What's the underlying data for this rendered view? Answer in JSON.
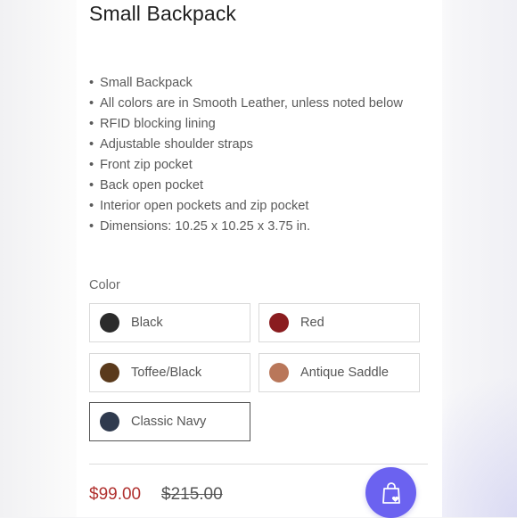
{
  "product": {
    "title": "Small Backpack",
    "features": [
      "Small Backpack",
      "All colors are in Smooth Leather, unless noted below",
      "RFID blocking lining",
      "Adjustable shoulder straps",
      "Front zip pocket",
      "Back open pocket",
      "Interior open pockets and zip pocket",
      "Dimensions: 10.25 x 10.25 x 3.75 in."
    ],
    "bullet": "•"
  },
  "color_picker": {
    "label": "Color",
    "options": [
      {
        "name": "Black",
        "swatch": "#2b2b2b",
        "selected": false
      },
      {
        "name": "Red",
        "swatch": "#8a1c1f",
        "selected": false
      },
      {
        "name": "Toffee/Black",
        "swatch": "#5a3a1c",
        "selected": false
      },
      {
        "name": "Antique Saddle",
        "swatch": "#b9775a",
        "selected": false
      },
      {
        "name": "Classic Navy",
        "swatch": "#2f3a4e",
        "selected": true
      }
    ]
  },
  "pricing": {
    "sale_price": "$99.00",
    "original_price": "$215.00",
    "sale_color": "#b0302e"
  },
  "cart_button": {
    "icon": "shopping-bag-heart-icon",
    "color": "#6b62f0"
  }
}
